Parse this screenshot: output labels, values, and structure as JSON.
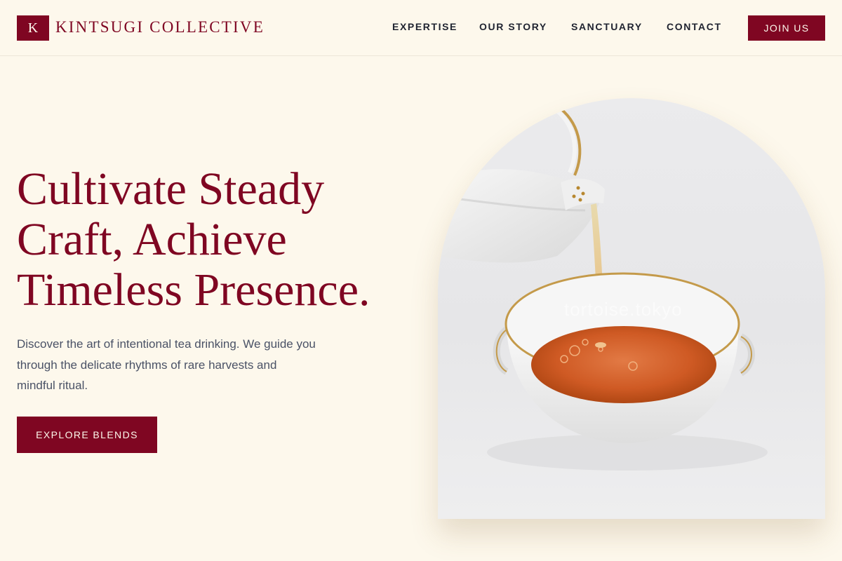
{
  "brand": {
    "mark": "K",
    "name": "KINTSUGI COLLECTIVE"
  },
  "nav": {
    "items": [
      {
        "label": "EXPERTISE"
      },
      {
        "label": "OUR STORY"
      },
      {
        "label": "SANCTUARY"
      },
      {
        "label": "CONTACT"
      }
    ],
    "cta_label": "JOIN US"
  },
  "hero": {
    "title_lines": [
      "Cultivate Steady",
      "Craft, Achieve",
      "Timeless Presence."
    ],
    "subtitle_lines": [
      "Discover the art of intentional tea drinking. We guide you",
      "through the delicate rhythms of rare harvests and",
      "mindful ritual."
    ],
    "cta_label": "EXPLORE BLENDS",
    "image": {
      "subject": "teapot-pouring-tea-into-bowl",
      "watermark": "tortoise.tokyo"
    }
  },
  "colors": {
    "accent": "#7f0622",
    "background": "#fdf8ec",
    "text_dark": "#1f2330",
    "text_muted": "#4a5266"
  }
}
